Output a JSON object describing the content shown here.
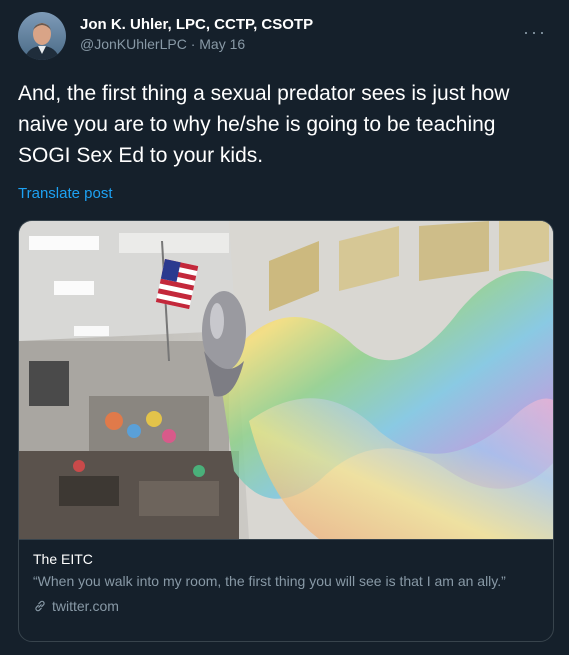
{
  "tweet": {
    "author": {
      "display_name": "Jon K. Uhler, LPC, CCTP, CSOTP",
      "handle": "@JonKUhlerLPC",
      "separator": "·",
      "date": "May 16"
    },
    "more_menu_label": "···",
    "text": "And, the first thing a sexual predator sees is just how naive you are to why he/she is going to be teaching SOGI Sex Ed to your kids.",
    "translate_label": "Translate post",
    "card": {
      "title": "The EITC",
      "description": "“When you walk into my room, the first thing you will see is that I am an ally.”",
      "domain": "twitter.com"
    }
  },
  "colors": {
    "background": "#15202b",
    "text_primary": "#ffffff",
    "text_secondary": "#8899a6",
    "link": "#1da1f2",
    "border": "#38444d"
  },
  "icons": {
    "more": "more-horizontal-icon",
    "link": "link-icon"
  }
}
